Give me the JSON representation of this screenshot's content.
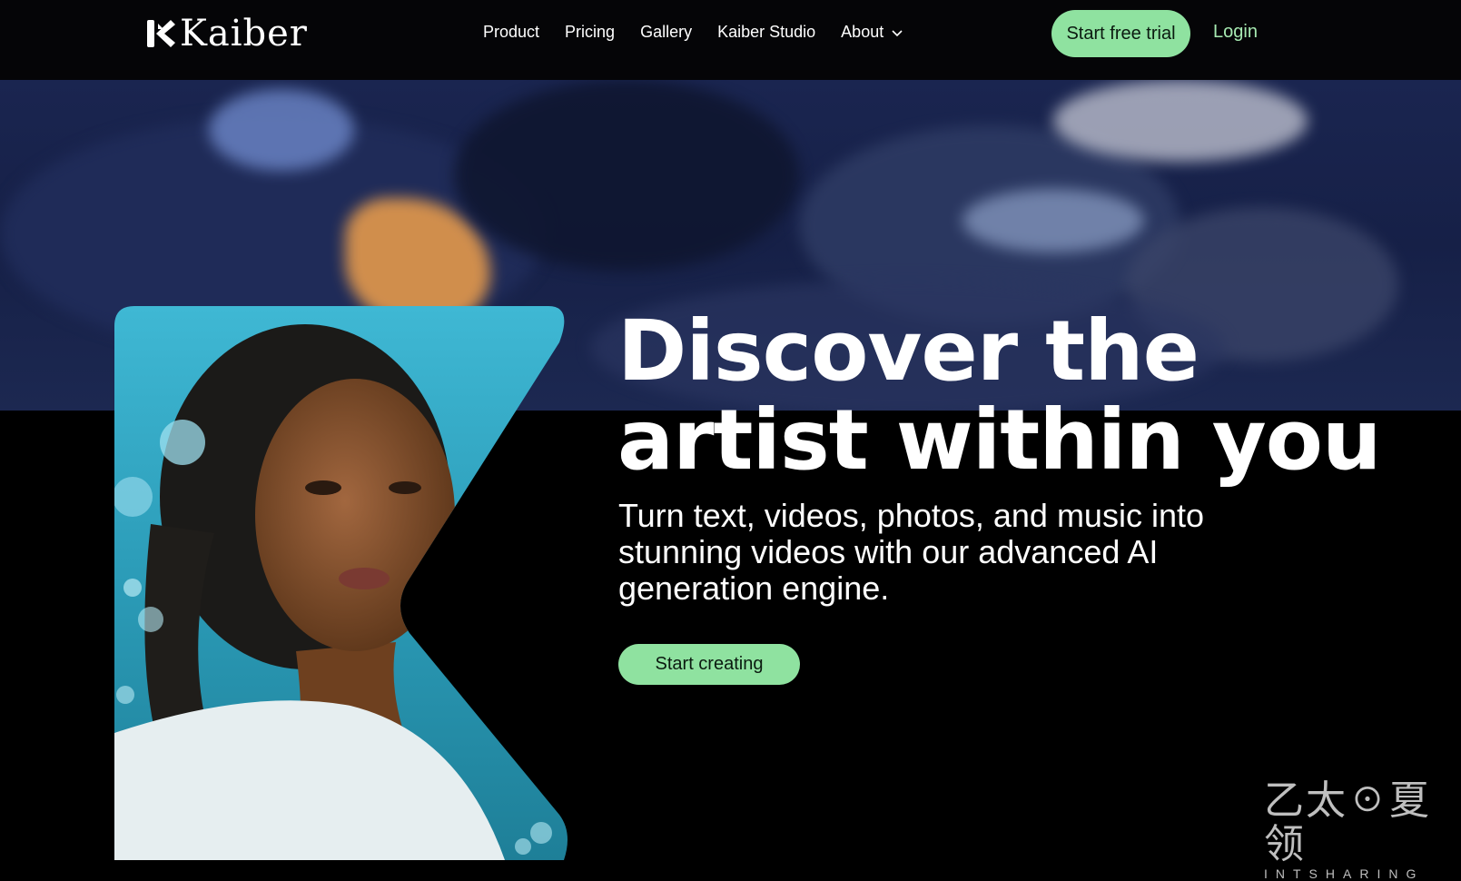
{
  "brand": {
    "name": "Kaiber"
  },
  "nav": {
    "links": [
      "Product",
      "Pricing",
      "Gallery",
      "Kaiber Studio"
    ],
    "about_label": "About",
    "trial_label": "Start free trial",
    "login_label": "Login"
  },
  "hero": {
    "headline_line1": "Discover the",
    "headline_line2": "artist within you",
    "subtext": "Turn text, videos, photos, and music into stunning videos with our advanced AI generation engine.",
    "cta_label": "Start creating"
  },
  "watermark": {
    "glyphs": "乙太☉夏领",
    "text": "INTSHARING"
  },
  "colors": {
    "accent": "#8fe2a0",
    "login_text": "#a7eab2",
    "background": "#000000",
    "nav_background": "#050507"
  },
  "icons": [
    "kaiber-logo-mark",
    "chevron-down-icon"
  ]
}
